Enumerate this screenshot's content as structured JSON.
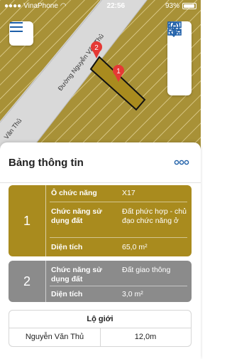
{
  "status_bar": {
    "carrier": "VinaPhone",
    "time": "22:56",
    "battery": "93%"
  },
  "map": {
    "street_label": "Đường Nguyễn Văn Thủ",
    "street_label_left": "Văn Thủ",
    "marker_1": "1",
    "marker_2": "2"
  },
  "sheet": {
    "title": "Bảng thông tin",
    "cards": [
      {
        "number": "1",
        "color": "#a98b1e",
        "o_chuc_nang_label": "Ô chức năng",
        "o_chuc_nang_value": "X17",
        "chuc_nang_label": "Chức năng sử dụng đất",
        "chuc_nang_value": "Đất phức hợp - chủ đạo chức năng ở",
        "dien_tich_label": "Diện tích",
        "dien_tich_value": "65,0 m²"
      },
      {
        "number": "2",
        "color": "#8b8b8b",
        "chuc_nang_label": "Chức năng sử dụng đất",
        "chuc_nang_value": "Đất giao thông",
        "dien_tich_label": "Diện tích",
        "dien_tich_value": "3,0 m²"
      }
    ],
    "lo_gioi": {
      "title": "Lộ giới",
      "street": "Nguyễn Văn Thủ",
      "width": "12,0m"
    }
  }
}
